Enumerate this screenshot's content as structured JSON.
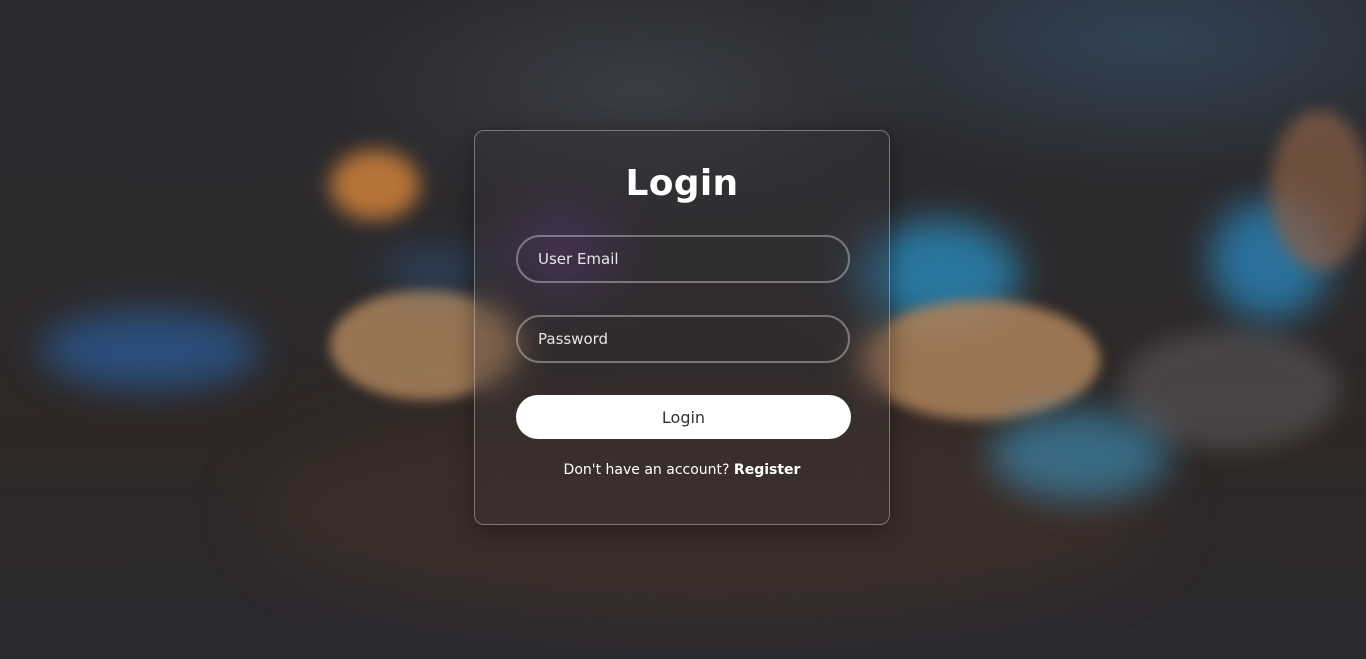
{
  "login_form": {
    "title": "Login",
    "email_placeholder": "User Email",
    "password_placeholder": "Password",
    "submit_label": "Login",
    "register_prompt": "Don't have an account?",
    "register_link": "Register"
  },
  "colors": {
    "button_background": "#ffffff",
    "button_text": "#333333",
    "text": "#ffffff"
  }
}
